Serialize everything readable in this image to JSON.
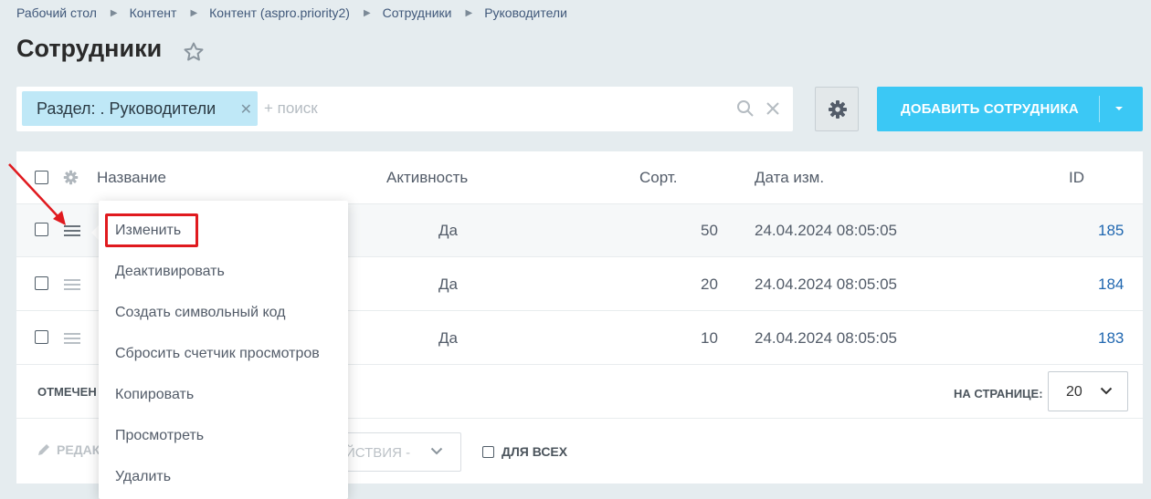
{
  "breadcrumb": [
    "Рабочий стол",
    "Контент",
    "Контент (aspro.priority2)",
    "Сотрудники",
    "Руководители"
  ],
  "page": {
    "title": "Сотрудники"
  },
  "filter": {
    "chip_label": "Раздел: . Руководители",
    "chip_close": "✕",
    "search_placeholder": "+ поиск"
  },
  "toolbar": {
    "add_label": "ДОБАВИТЬ СОТРУДНИКА"
  },
  "grid": {
    "columns": {
      "name": "Название",
      "active": "Активность",
      "sort": "Сорт.",
      "date": "Дата изм.",
      "id": "ID"
    },
    "rows": [
      {
        "active": "Да",
        "sort": "50",
        "date": "24.04.2024 08:05:05",
        "id": "185"
      },
      {
        "active": "Да",
        "sort": "20",
        "date": "24.04.2024 08:05:05",
        "id": "184"
      },
      {
        "active": "Да",
        "sort": "10",
        "date": "24.04.2024 08:05:05",
        "id": "183"
      }
    ],
    "footer": {
      "selected_label": "ОТМЕЧЕН",
      "per_page_label": "НА СТРАНИЦЕ:",
      "per_page_value": "20"
    },
    "actions": {
      "edit_label": "РЕДАК",
      "actions_label": "ЕЙСТВИЯ -",
      "for_all_label": "ДЛЯ ВСЕХ"
    }
  },
  "context_menu": {
    "items": [
      "Изменить",
      "Деактивировать",
      "Создать символьный код",
      "Сбросить счетчик просмотров",
      "Копировать",
      "Просмотреть",
      "Удалить"
    ]
  },
  "colors": {
    "accent": "#3bc8f5",
    "chip": "#bfe8f7",
    "link": "#2067b0",
    "annotation": "#e01a1f"
  }
}
